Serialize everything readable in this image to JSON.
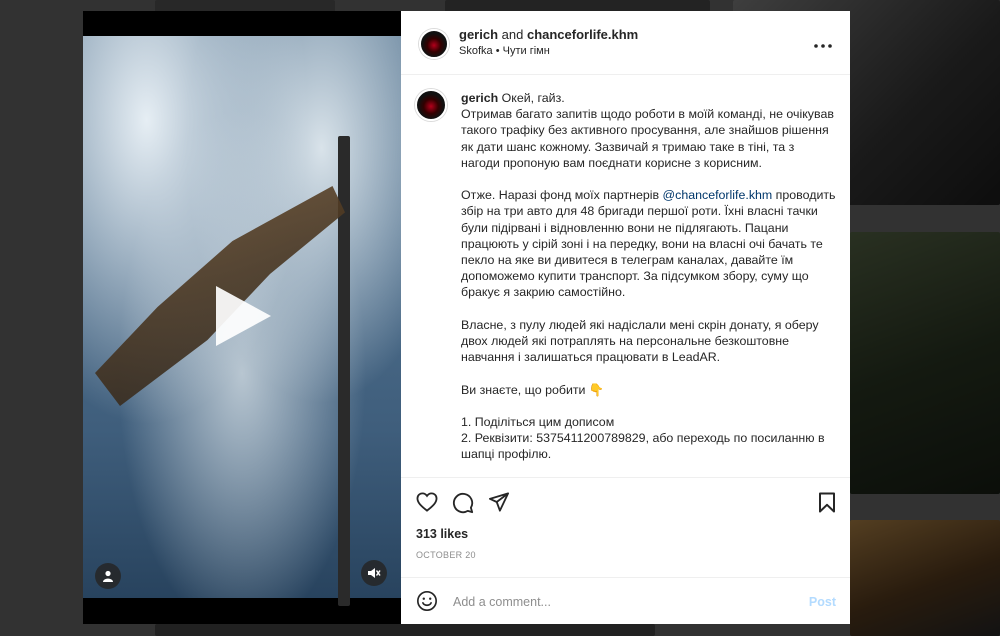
{
  "header": {
    "author": "gerich",
    "and_text": "and",
    "coauthor": "chanceforlife.khm",
    "audio_artist": "Skofka",
    "separator": "•",
    "audio_title": "Чути гімн",
    "more_icon": "more-horizontal-icon"
  },
  "caption": {
    "username": "gerich",
    "first_line": "Окей, гайз.",
    "body_part1": "\nОтримав багато запитів щодо роботи в моїй команді, не очікував такого трафіку без активного просування, але знайшов рішення як дати шанс кожному. Зазвичай я тримаю таке в тіні, та з нагоди пропоную вам поєднати корисне з корисним.\n\nОтже. Наразі фонд моїх партнерів ",
    "mention": "@chanceforlife.khm",
    "body_part2": " проводить збір на три авто для 48 бригади першої роти. Їхні власні тачки були підірвані і відновленню вони не підлягають. Пацани працюють у сірій зоні і на передку, вони на власні очі бачать те пекло на яке ви дивитеся в телеграм каналах, давайте їм допоможемо купити транспорт. За підсумком збору, суму що бракує я закрию самостійно.\n\nВласне, з пулу людей які надіслали мені скрін донату, я оберу двох людей які потраплять на персональне безкоштовне навчання і залишаться працювати в LeadAR.\n\nВи знаєте, що робити 👇\n\n1. Поділіться цим дописом\n2. Реквізити: 5375411200789829, або переходь по посиланню в шапці профілю."
  },
  "actions": {
    "like_icon": "heart-icon",
    "comment_icon": "comment-icon",
    "share_icon": "send-icon",
    "save_icon": "bookmark-icon"
  },
  "likes_text": "313 likes",
  "date_text": "OCTOBER 20",
  "comment": {
    "placeholder": "Add a comment...",
    "post_label": "Post",
    "emoji_icon": "emoji-icon"
  },
  "media": {
    "play_icon": "play-icon",
    "user_tag_icon": "user-icon",
    "mute_icon": "muted-speaker-icon"
  },
  "colors": {
    "link": "#00376b",
    "post_disabled": "#b3dbff",
    "secondary_text": "#8e8e8e"
  }
}
